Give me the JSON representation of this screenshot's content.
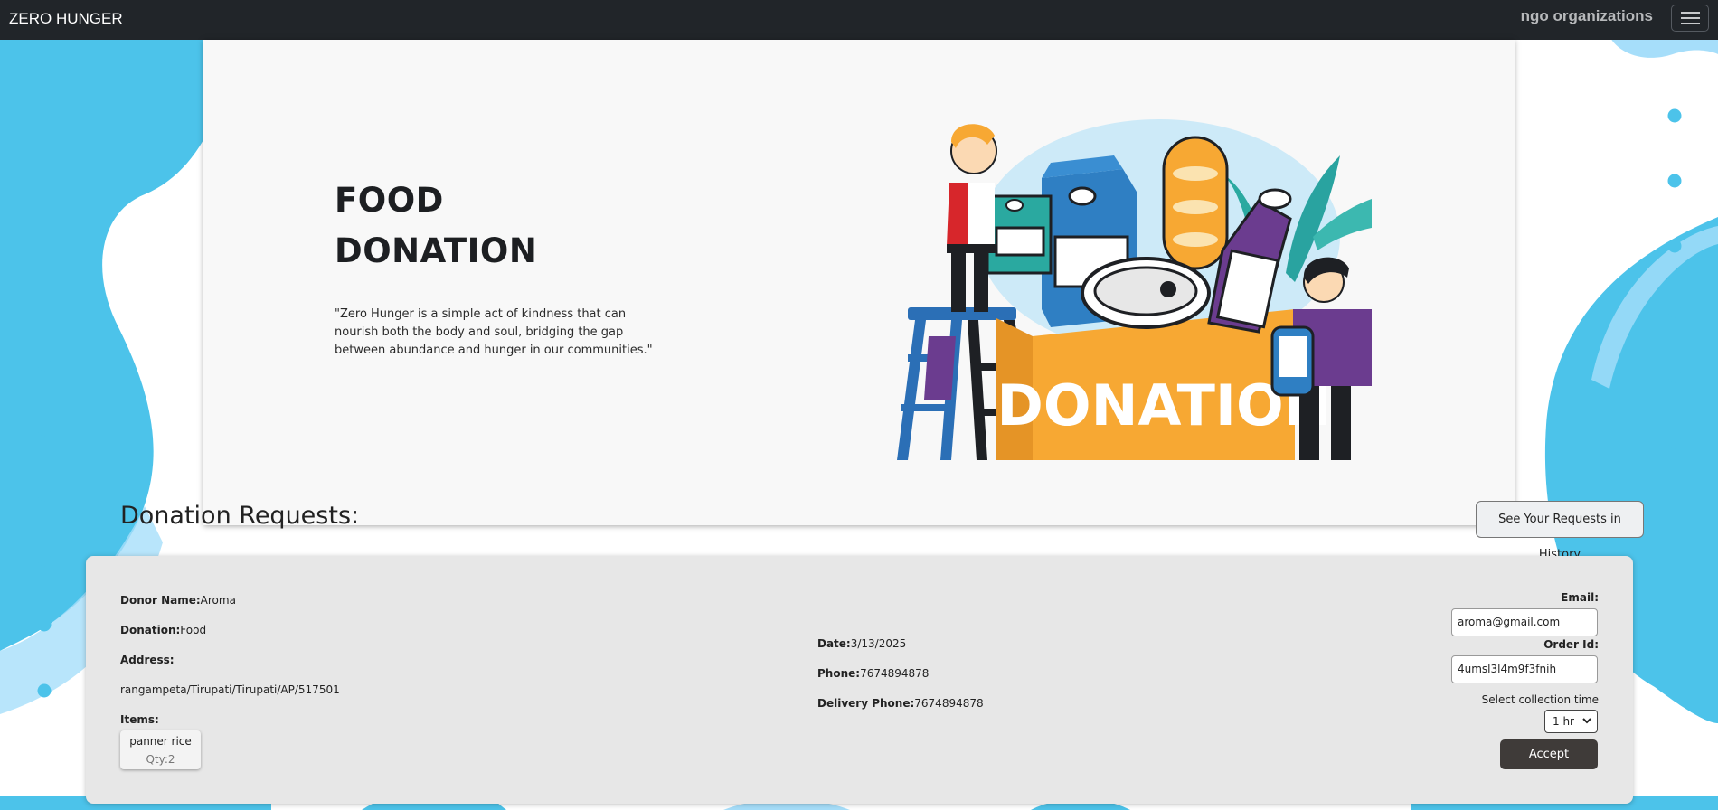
{
  "navbar": {
    "brand": "ZERO HUNGER",
    "right_link": "ngo organizations",
    "menu_icon": "hamburger-menu-icon"
  },
  "hero": {
    "title_line1": "FOOD",
    "title_line2": "DONATION",
    "quote": "\"Zero Hunger is a simple act of kindness that can nourish both the body and soul, bridging the gap between abundance and hunger in our communities.\"",
    "illustration_text": "DONATION"
  },
  "requests": {
    "heading": "Donation Requests:",
    "history_button": "See Your Requests in History",
    "items": [
      {
        "donor_name_label": "Donor Name:",
        "donor_name": "Aroma",
        "donation_label": "Donation:",
        "donation": "Food",
        "address_label": "Address:",
        "address": "rangampeta/Tirupati/Tirupati/AP/517501",
        "items_label": "Items:",
        "item_name": "panner rice",
        "qty_label": "Qty:",
        "qty": "2",
        "date_label": "Date:",
        "date": "3/13/2025",
        "phone_label": "Phone:",
        "phone": "7674894878",
        "delivery_phone_label": "Delivery Phone:",
        "delivery_phone": "7674894878",
        "email_label": "Email:",
        "email": "aroma@gmail.com",
        "order_id_label": "Order Id:",
        "order_id": "4umsl3l4m9f3fnih",
        "collection_label": "Select collection time",
        "collection_value": "1 hr",
        "accept_button": "Accept"
      }
    ]
  },
  "colors": {
    "navbar": "#212529",
    "bg_blue": "#4cc3ea",
    "bg_light_blue": "#a6defa",
    "accept": "#3f3b39",
    "box_orange": "#f7a833"
  }
}
